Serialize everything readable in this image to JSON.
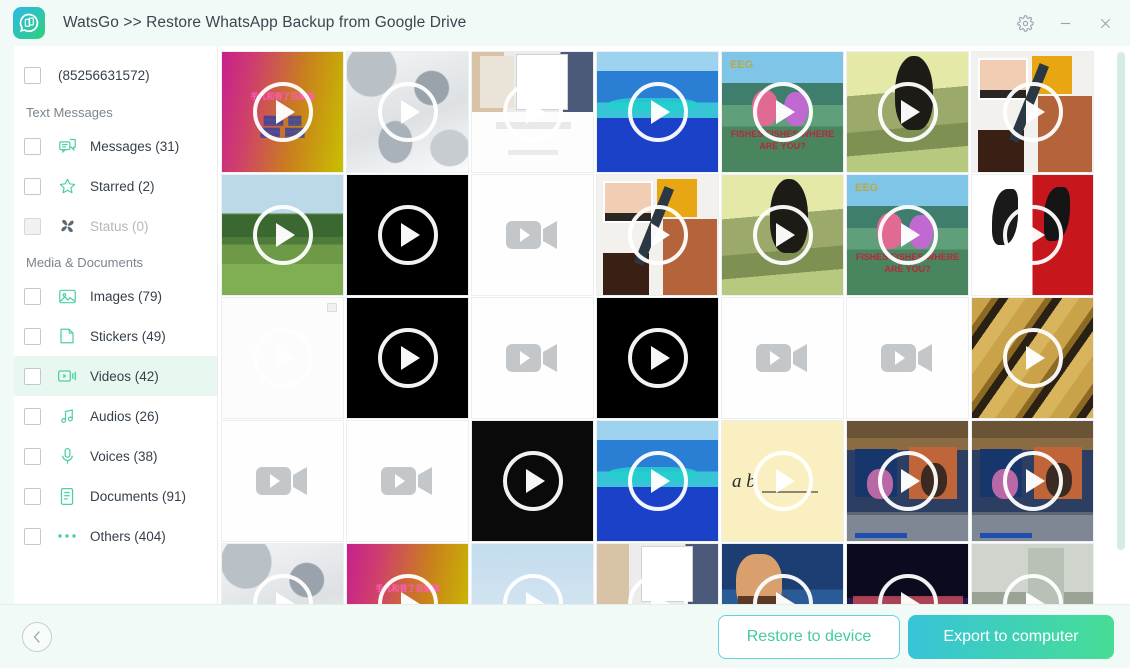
{
  "window": {
    "title": "WatsGo >> Restore WhatsApp Backup from Google Drive",
    "app_icon": "whatsapp-transfer-icon",
    "controls": {
      "settings": "gear-icon",
      "minimize": "minimize-icon",
      "close": "close-icon"
    },
    "accent_teal": "#44cc99",
    "accent_blue": "#37c4d8",
    "titlebar_bg": "#f2faf7"
  },
  "sidebar": {
    "account": {
      "label": "(85256631572)",
      "checked": false
    },
    "sections": [
      {
        "title": "Text Messages",
        "items": [
          {
            "label": "Messages (31)",
            "icon": "messages-icon",
            "checked": false,
            "active": false,
            "disabled": false
          },
          {
            "label": "Starred (2)",
            "icon": "star-icon",
            "checked": false,
            "active": false,
            "disabled": false
          },
          {
            "label": "Status (0)",
            "icon": "status-icon",
            "checked": false,
            "active": false,
            "disabled": true
          }
        ]
      },
      {
        "title": "Media & Documents",
        "items": [
          {
            "label": "Images (79)",
            "icon": "image-icon",
            "checked": false,
            "active": false,
            "disabled": false
          },
          {
            "label": "Stickers (49)",
            "icon": "sticker-icon",
            "checked": false,
            "active": false,
            "disabled": false
          },
          {
            "label": "Videos (42)",
            "icon": "video-icon",
            "checked": false,
            "active": true,
            "disabled": false
          },
          {
            "label": "Audios (26)",
            "icon": "audio-icon",
            "checked": false,
            "active": false,
            "disabled": false
          },
          {
            "label": "Voices (38)",
            "icon": "microphone-icon",
            "checked": false,
            "active": false,
            "disabled": false
          },
          {
            "label": "Documents (91)",
            "icon": "document-icon",
            "checked": false,
            "active": false,
            "disabled": false
          },
          {
            "label": "Others (404)",
            "icon": "ellipsis-icon",
            "checked": false,
            "active": false,
            "disabled": false
          }
        ]
      }
    ]
  },
  "grid": {
    "columns": 7,
    "scroll_position": "top",
    "thumbnails": [
      {
        "id": "v1",
        "kind": "video",
        "style": "gradient-magenta-yellow",
        "overlay_text": "手儿和音了百集篇",
        "play": "ring"
      },
      {
        "id": "v2",
        "kind": "video",
        "style": "chrome-rings",
        "play": "ring"
      },
      {
        "id": "v3",
        "kind": "video",
        "style": "screen-capture",
        "play": "ring"
      },
      {
        "id": "v4",
        "kind": "video",
        "style": "blue-ocean-island",
        "play": "ring"
      },
      {
        "id": "v5",
        "kind": "video",
        "style": "cartoon-fishes",
        "overlay_text": "FISHES FISHES WHERE ARE YOU?",
        "play": "ring"
      },
      {
        "id": "v6",
        "kind": "video",
        "style": "vintage-silhouette",
        "play": "ring"
      },
      {
        "id": "v7",
        "kind": "video",
        "style": "hand-drawing",
        "play": "ring"
      },
      {
        "id": "v8",
        "kind": "video",
        "style": "park-landscape",
        "play": "ring"
      },
      {
        "id": "v9",
        "kind": "video",
        "style": "black",
        "play": "ring"
      },
      {
        "id": "v10",
        "kind": "video",
        "style": "placeholder",
        "play": "camera"
      },
      {
        "id": "v11",
        "kind": "video",
        "style": "hand-drawing",
        "play": "ring"
      },
      {
        "id": "v12",
        "kind": "video",
        "style": "vintage-silhouette",
        "play": "ring"
      },
      {
        "id": "v13",
        "kind": "video",
        "style": "cartoon-fishes",
        "overlay_text": "FISHES FISHES WHERE ARE YOU?",
        "play": "ring"
      },
      {
        "id": "v14",
        "kind": "video",
        "style": "red-white-calligraphy",
        "play": "ring"
      },
      {
        "id": "v15",
        "kind": "video",
        "style": "blank-white",
        "play": "ring-faint",
        "badge": "broken-image"
      },
      {
        "id": "v16",
        "kind": "video",
        "style": "black",
        "play": "ring"
      },
      {
        "id": "v17",
        "kind": "video",
        "style": "placeholder",
        "play": "camera"
      },
      {
        "id": "v18",
        "kind": "video",
        "style": "black",
        "play": "ring"
      },
      {
        "id": "v19",
        "kind": "video",
        "style": "placeholder",
        "play": "camera"
      },
      {
        "id": "v20",
        "kind": "video",
        "style": "placeholder",
        "play": "camera"
      },
      {
        "id": "v21",
        "kind": "video",
        "style": "gold-bars",
        "play": "ring"
      },
      {
        "id": "v22",
        "kind": "video",
        "style": "placeholder",
        "play": "camera"
      },
      {
        "id": "v23",
        "kind": "video",
        "style": "placeholder",
        "play": "camera"
      },
      {
        "id": "v24",
        "kind": "video",
        "style": "black",
        "play": "ring"
      },
      {
        "id": "v25",
        "kind": "video",
        "style": "blue-ocean-island",
        "play": "ring"
      },
      {
        "id": "v26",
        "kind": "video",
        "style": "cream-handwriting",
        "overlay_text": "a b",
        "play": "ring"
      },
      {
        "id": "v27",
        "kind": "video",
        "style": "tv-broadcast",
        "play": "ring"
      },
      {
        "id": "v28",
        "kind": "video",
        "style": "tv-broadcast",
        "play": "ring"
      },
      {
        "id": "v29",
        "kind": "video",
        "style": "chrome-rings",
        "play": "ring"
      },
      {
        "id": "v30",
        "kind": "video",
        "style": "gradient-magenta-yellow",
        "overlay_text": "手儿和音了百集篇",
        "play": "ring"
      },
      {
        "id": "v31",
        "kind": "video",
        "style": "pale-sky",
        "play": "ring"
      },
      {
        "id": "v32",
        "kind": "video",
        "style": "screen-capture",
        "play": "ring"
      },
      {
        "id": "v33",
        "kind": "video",
        "style": "film-scene",
        "play": "ring"
      },
      {
        "id": "v34",
        "kind": "video",
        "style": "concert-stage",
        "play": "ring"
      },
      {
        "id": "v35",
        "kind": "video",
        "style": "dim-interior",
        "play": "ring"
      }
    ]
  },
  "footer": {
    "back": "back-arrow-icon",
    "restore_label": "Restore to device",
    "export_label": "Export to computer"
  }
}
